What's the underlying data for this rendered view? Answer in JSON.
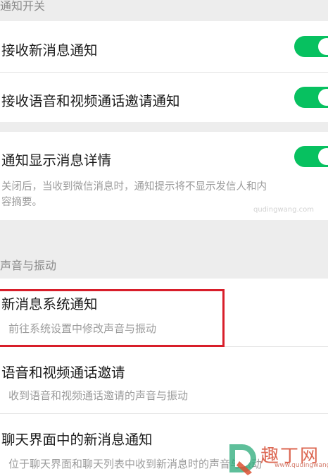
{
  "section_notification": {
    "header": "通知开关",
    "items": [
      {
        "title": "接收新消息通知",
        "enabled": true
      },
      {
        "title": "接收语音和视频通话邀请通知",
        "enabled": true
      }
    ]
  },
  "detail_card": {
    "title": "通知显示消息详情",
    "enabled": true,
    "description_line1": "关闭后，当收到微信消息时，通知提示将不显示发信人和内",
    "description_line2": "容摘要。"
  },
  "section_sound": {
    "header": "声音与振动",
    "items": [
      {
        "title": "新消息系统通知",
        "subtitle": "前往系统设置中修改声音与振动"
      },
      {
        "title": "语音和视频通话邀请",
        "subtitle": "收到语音和视频通话邀请的声音与振动"
      },
      {
        "title": "聊天界面中的新消息通知",
        "subtitle": "位于聊天界面和聊天列表中收到新消息时的声音与振动"
      }
    ]
  },
  "watermark": {
    "text": "趣丁网",
    "url": "www.qudingwang.com",
    "faint": "qudingwang.com"
  },
  "colors": {
    "toggle_on": "#07c160",
    "highlight": "#d81e2a",
    "background": "#ededed"
  }
}
